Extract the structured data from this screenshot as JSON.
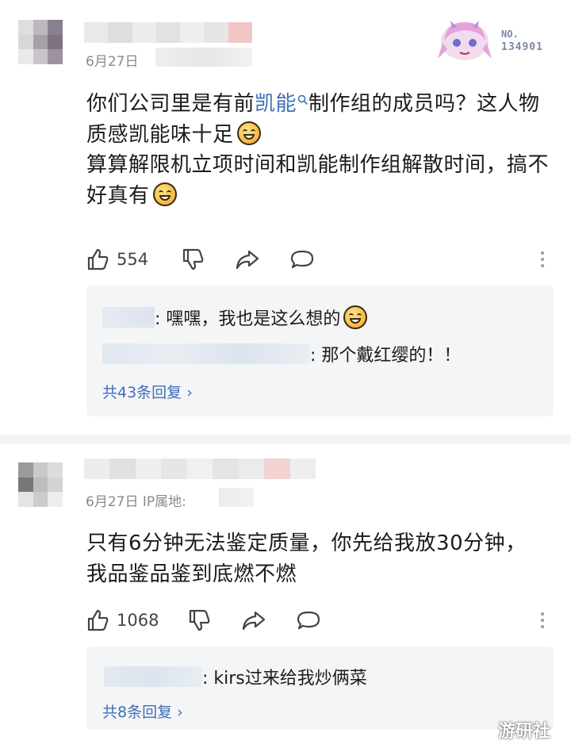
{
  "comments": [
    {
      "date": "6月27日",
      "ip_label": "",
      "text_parts": [
        {
          "t": "你们公司里是有前"
        },
        {
          "t": "凯能",
          "kw": true
        },
        {
          "t": "制作组的成员吗？这人物质感凯能味十足"
        },
        {
          "emoji": "grin-emoji"
        },
        {
          "br": true
        },
        {
          "t": "算算解限机立项时间和凯能制作组解散时间，搞不好真有"
        },
        {
          "emoji": "grin-emoji"
        }
      ],
      "likes": "554",
      "replies": [
        {
          "text": ": 嘿嘿，我也是这么想的",
          "emoji": "grin-emoji"
        },
        {
          "text": ": 那个戴红缨的！！"
        }
      ],
      "more_replies": "共43条回复 ›"
    },
    {
      "date": "6月27日 IP属地:",
      "text_parts": [
        {
          "t": "只有6分钟无法鉴定质量，你先给我放30分钟，我品鉴品鉴到底燃不燃"
        }
      ],
      "likes": "1068",
      "replies": [
        {
          "text": ": kirs过来给我炒俩菜"
        }
      ],
      "more_replies": "共8条回复 ›"
    }
  ],
  "badge": {
    "label": "NO.",
    "number": "134901"
  },
  "watermark": "游研社",
  "colors": {
    "link": "#3f6fb6",
    "reply_bg": "#f4f5f7",
    "muted": "#8a8a8a"
  }
}
